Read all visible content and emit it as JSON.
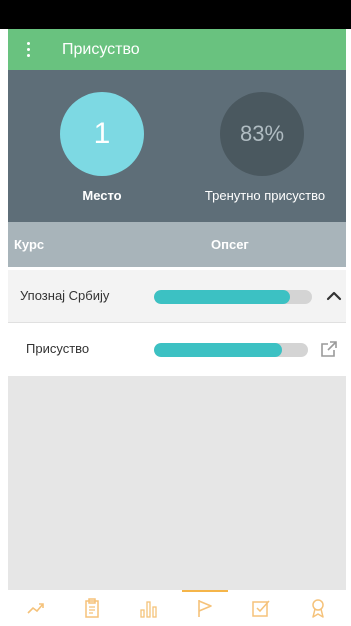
{
  "app": {
    "title": "Присуство",
    "accent_color": "#69c27f"
  },
  "summary": {
    "rank_value": "1",
    "rank_label": "Место",
    "attendance_value": "83%",
    "attendance_label": "Тренутно присуство"
  },
  "table": {
    "header": {
      "course": "Курс",
      "range": "Опсег"
    },
    "rows": [
      {
        "label": "Упознај Србију",
        "progress": 0.86,
        "icon": "chevron-up-icon"
      },
      {
        "label": "Присуство",
        "progress": 0.83,
        "icon": "external-link-icon"
      }
    ]
  },
  "bottom_nav": {
    "active_index": 3,
    "items": [
      {
        "icon": "trend-icon"
      },
      {
        "icon": "clipboard-icon"
      },
      {
        "icon": "bar-chart-icon"
      },
      {
        "icon": "flag-icon"
      },
      {
        "icon": "checkbox-icon"
      },
      {
        "icon": "award-icon"
      }
    ],
    "icon_color": "#f5c27a"
  }
}
